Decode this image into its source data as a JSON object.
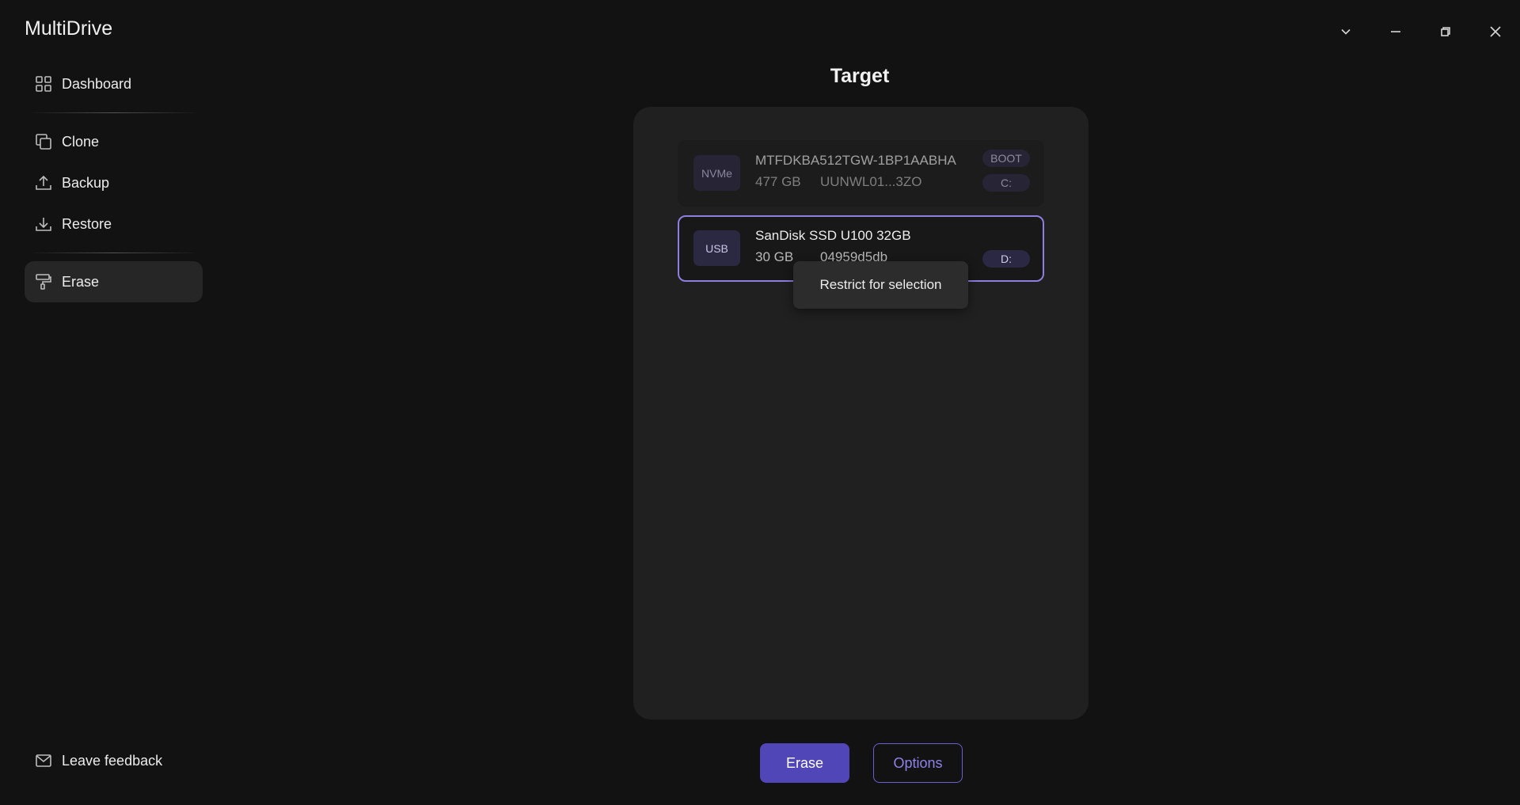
{
  "app": {
    "title": "MultiDrive"
  },
  "window_controls": {
    "items": [
      {
        "name": "dropdown",
        "icon": "chevron-down-icon"
      },
      {
        "name": "minimize",
        "icon": "minimize-icon"
      },
      {
        "name": "restore",
        "icon": "restore-icon"
      },
      {
        "name": "close",
        "icon": "close-icon"
      }
    ]
  },
  "sidebar": {
    "items": [
      {
        "label": "Dashboard",
        "icon": "dashboard-grid-icon",
        "active": false
      },
      {
        "label": "Clone",
        "icon": "clone-copy-icon",
        "active": false
      },
      {
        "label": "Backup",
        "icon": "upload-icon",
        "active": false
      },
      {
        "label": "Restore",
        "icon": "download-icon",
        "active": false
      },
      {
        "label": "Erase",
        "icon": "paint-roller-icon",
        "active": true
      }
    ],
    "feedback": {
      "label": "Leave feedback",
      "icon": "mail-icon"
    }
  },
  "main": {
    "title": "Target",
    "drives": [
      {
        "type": "NVMe",
        "name": "MTFDKBA512TGW-1BP1AABHA",
        "size": "477 GB",
        "serial": "UUNWL01...3ZO",
        "tags": [
          "BOOT",
          "C:"
        ],
        "state": "disabled"
      },
      {
        "type": "USB",
        "name": "SanDisk SSD U100 32GB",
        "size": "30 GB",
        "serial": "04959d5db",
        "tags": [
          "D:"
        ],
        "state": "selected"
      }
    ],
    "tooltip": "Restrict for selection"
  },
  "actions": {
    "erase_label": "Erase",
    "options_label": "Options"
  },
  "colors": {
    "background": "#121212",
    "panel": "#202020",
    "accent": "#5146b8",
    "accent_outline": "#6a5fd0",
    "selected_border": "#8c7fe0"
  }
}
